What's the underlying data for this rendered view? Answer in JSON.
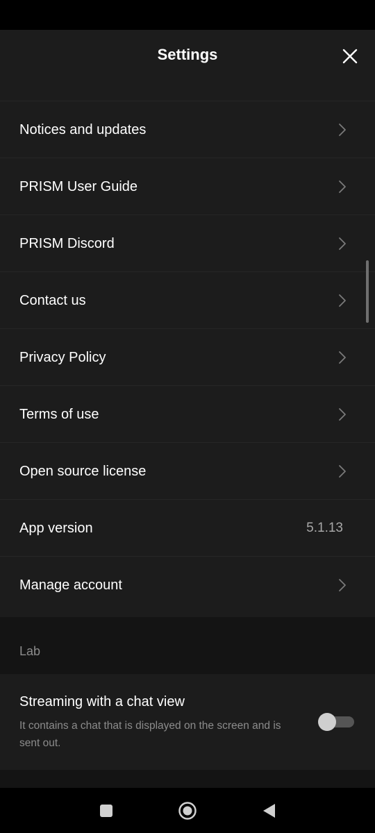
{
  "header": {
    "title": "Settings",
    "close_icon": "close-icon"
  },
  "rows": [
    {
      "label": "Notices and updates",
      "has_chevron": true
    },
    {
      "label": "PRISM User Guide",
      "has_chevron": true
    },
    {
      "label": "PRISM Discord",
      "has_chevron": true
    },
    {
      "label": "Contact us",
      "has_chevron": true
    },
    {
      "label": "Privacy Policy",
      "has_chevron": true
    },
    {
      "label": "Terms of use",
      "has_chevron": true
    },
    {
      "label": "Open source license",
      "has_chevron": true
    },
    {
      "label": "App version",
      "value": "5.1.13",
      "has_chevron": false
    },
    {
      "label": "Manage account",
      "has_chevron": true
    }
  ],
  "lab": {
    "section_label": "Lab",
    "title": "Streaming with a chat view",
    "description": "It contains a chat that is displayed on the screen and is sent out.",
    "toggle_on": false
  },
  "nav": {
    "recents_icon": "square-icon",
    "home_icon": "circle-icon",
    "back_icon": "back-triangle-icon"
  },
  "colors": {
    "background": "#1c1c1c",
    "text": "#ffffff",
    "muted": "#8c8c8c"
  }
}
